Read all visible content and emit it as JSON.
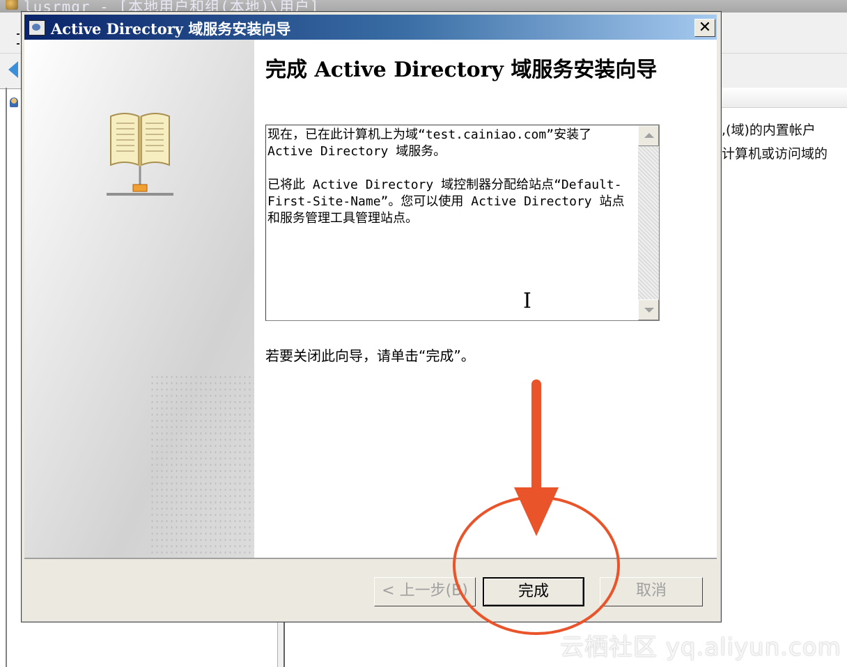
{
  "background_window": {
    "title": "lusrmgr - [本地用户和组(本地)\\用户]",
    "description_line1": ",(域)的内置帐户",
    "description_line2": "计算机或访问域的"
  },
  "dialog": {
    "title": "Active Directory 域服务安装向导",
    "close_label": "✕",
    "heading": "完成 Active Directory 域服务安装向导",
    "summary": {
      "paragraph1": "现在，已在此计算机上为域“test.cainiao.com”安装了 Active Directory 域服务。",
      "paragraph2": "已将此 Active Directory 域控制器分配给站点“Default-First-Site-Name”。您可以使用 Active Directory 站点和服务管理工具管理站点。"
    },
    "close_hint": "若要关闭此向导，请单击“完成”。",
    "buttons": {
      "back": "< 上一步(B)",
      "finish": "完成",
      "cancel": "取消"
    }
  },
  "annotation": {
    "color": "#e9542b",
    "shapes": [
      "arrow-down",
      "circle"
    ]
  },
  "watermark": "云栖社区 yq.aliyun.com"
}
